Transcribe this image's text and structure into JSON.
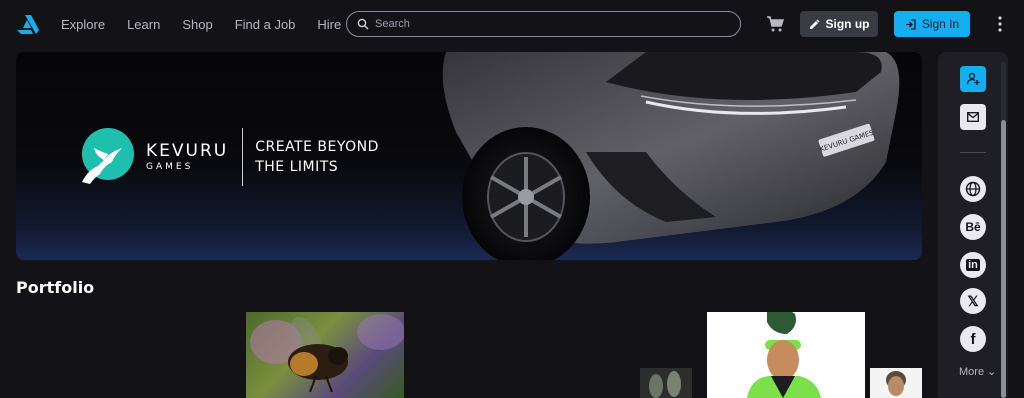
{
  "nav": {
    "items": [
      {
        "label": "Explore"
      },
      {
        "label": "Learn"
      },
      {
        "label": "Shop"
      },
      {
        "label": "Find a Job"
      },
      {
        "label": "Hire"
      }
    ]
  },
  "search": {
    "placeholder": "Search",
    "value": ""
  },
  "header": {
    "signup_label": "Sign up",
    "signin_label": "Sign In"
  },
  "banner": {
    "brand_name": "KEVURU",
    "brand_sub": "GAMES",
    "tagline_line1": "CREATE BEYOND",
    "tagline_line2": "THE LIMITS",
    "plate_text": "KEVURU GAMES"
  },
  "portfolio": {
    "title": "Portfolio"
  },
  "rail": {
    "socials": [
      "globe-icon",
      "behance-icon",
      "linkedin-icon",
      "x-icon",
      "facebook-icon"
    ],
    "behance_text": "Bē",
    "linkedin_text": "in",
    "x_text": "𝕏",
    "facebook_text": "f",
    "more_label": "More"
  },
  "colors": {
    "accent": "#13aff0",
    "bg": "#131217",
    "rail": "#1f1e25",
    "brand_teal": "#1fbfae"
  }
}
